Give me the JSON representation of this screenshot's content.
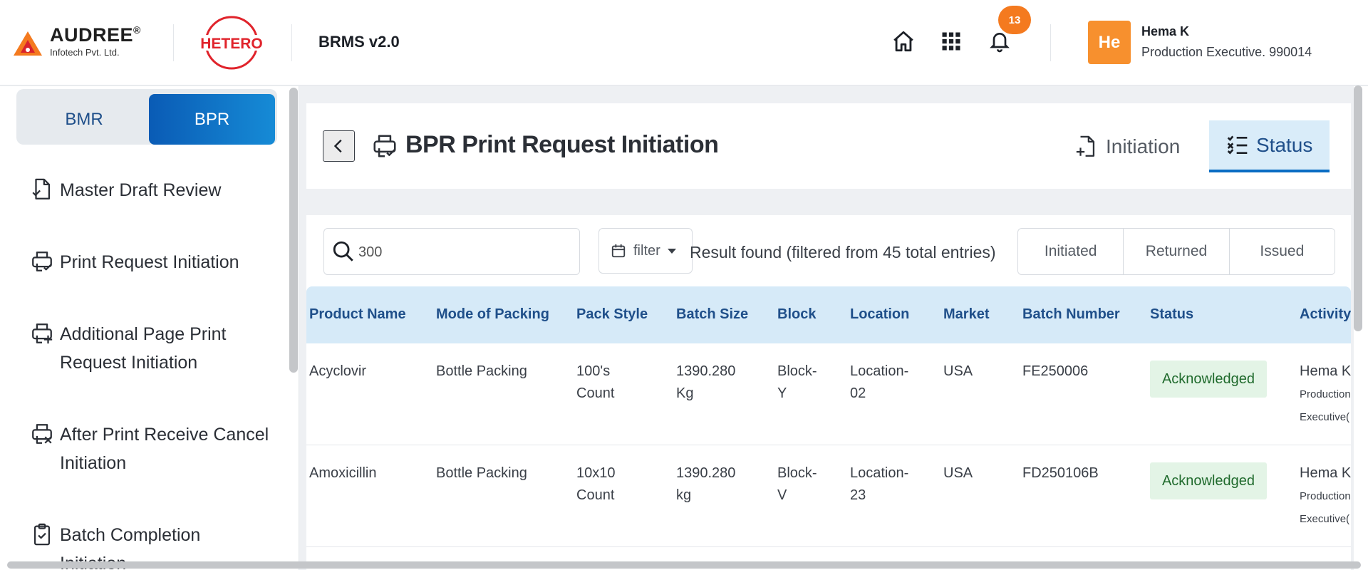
{
  "header": {
    "brand_name": "AUDREE",
    "brand_reg": "®",
    "brand_sub": "Infotech Pvt. Ltd.",
    "client_logo_text": "HETERO",
    "app_title": "BRMS v2.0",
    "notification_count": "13",
    "user": {
      "initials": "He",
      "name": "Hema K",
      "role": "Production Executive. 990014"
    },
    "colors": {
      "accent": "#f47a1f",
      "avatar": "#f7902e",
      "primary": "#0a5bb5"
    }
  },
  "sidebar": {
    "toggle": {
      "left": "BMR",
      "right": "BPR",
      "active": "BPR"
    },
    "items": [
      {
        "label": "Master Draft Review",
        "icon": "document-check-icon"
      },
      {
        "label": "Print Request Initiation",
        "icon": "printer-check-icon"
      },
      {
        "label_line1": "Additional Page Print",
        "label_line2": "Request Initiation",
        "icon": "printer-plus-icon"
      },
      {
        "label_line1": "After Print Receive Cancel",
        "label_line2": "Initiation",
        "icon": "printer-x-icon"
      },
      {
        "label_line1": "Batch Completion",
        "label_line2": "Initiation",
        "icon": "clipboard-check-icon"
      }
    ]
  },
  "page": {
    "title": "BPR Print Request Initiation",
    "tabs": {
      "initiation": "Initiation",
      "status": "Status",
      "active": "Status"
    }
  },
  "toolbar": {
    "search_value": "300",
    "filter_label": "filter",
    "result_text": "Result found (filtered from 45 total entries)",
    "status_filters": [
      "Initiated",
      "Returned",
      "Issued"
    ]
  },
  "table": {
    "columns": [
      "Product Name",
      "Mode of Packing",
      "Pack Style",
      "Batch Size",
      "Block",
      "Location",
      "Market",
      "Batch Number",
      "Status",
      "Activity"
    ],
    "rows": [
      {
        "product": "Acyclovir",
        "mode": "Bottle Packing",
        "pack_style_1": "100's",
        "pack_style_2": "Count",
        "batch_size_1": "1390.280",
        "batch_size_2": "Kg",
        "block_1": "Block-",
        "block_2": "Y",
        "location_1": "Location-",
        "location_2": "02",
        "market": "USA",
        "batch_number": "FE250006",
        "status": "Acknowledged",
        "activity_name": "Hema K",
        "activity_role_1": "Production",
        "activity_role_2": "Executive("
      },
      {
        "product": "Amoxicillin",
        "mode": "Bottle Packing",
        "pack_style_1": "10x10",
        "pack_style_2": "Count",
        "batch_size_1": "1390.280",
        "batch_size_2": "kg",
        "block_1": "Block-",
        "block_2": "V",
        "location_1": "Location-",
        "location_2": "23",
        "market": "USA",
        "batch_number": "FD250106B",
        "status": "Acknowledged",
        "activity_name": "Hema K",
        "activity_role_1": "Production",
        "activity_role_2": "Executive("
      }
    ]
  }
}
